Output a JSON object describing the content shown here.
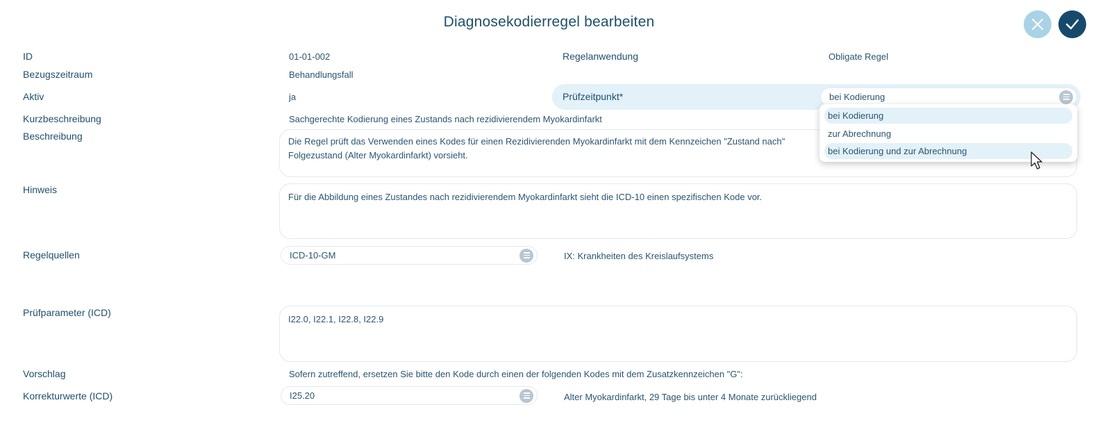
{
  "dialog": {
    "title": "Diagnosekodierregel bearbeiten"
  },
  "actions": {
    "cancel_icon": "close-icon",
    "save_icon": "check-icon"
  },
  "fields": {
    "id": {
      "label": "ID",
      "value": "01-01-002"
    },
    "regelanwendung": {
      "label": "Regelanwendung",
      "value": "Obligate Regel"
    },
    "bezugszeitraum": {
      "label": "Bezugszeitraum",
      "value": "Behandlungsfall"
    },
    "aktiv": {
      "label": "Aktiv",
      "value": "ja"
    },
    "pruefzeitpunkt": {
      "label": "Prüfzeitpunkt*",
      "value": "bei Kodierung",
      "options": [
        "bei Kodierung",
        "zur Abrechnung",
        "bei Kodierung und zur Abrechnung"
      ]
    },
    "kurzbeschreibung": {
      "label": "Kurzbeschreibung",
      "value": "Sachgerechte Kodierung eines Zustands nach rezidivierendem Myokardinfarkt"
    },
    "beschreibung": {
      "label": "Beschreibung",
      "line1": "Die Regel prüft das Verwenden eines Kodes für einen Rezidivierenden Myokardinfarkt mit dem Kennzeichen \"Zustand nach\"",
      "line2": "Folgezustand (Alter Myokardinfarkt) vorsieht."
    },
    "hinweis": {
      "label": "Hinweis",
      "value": "Für die Abbildung eines Zustandes nach rezidivierendem Myokardinfarkt sieht die ICD-10 einen spezifischen Kode vor."
    },
    "regelquellen": {
      "label": "Regelquellen",
      "value": "ICD-10-GM",
      "description": "IX: Krankheiten des Kreislaufsystems"
    },
    "pruefparameter": {
      "label": "Prüfparameter (ICD)",
      "value": "I22.0, I22.1, I22.8, I22.9"
    },
    "vorschlag": {
      "label": "Vorschlag",
      "value": "Sofern zutreffend, ersetzen Sie bitte den Kode durch einen der folgenden Kodes mit dem Zusatzkennzeichen \"G\":"
    },
    "korrekturwerte": {
      "label": "Korrekturwerte (ICD)",
      "value": "I25.20",
      "description": "Alter Myokardinfarkt, 29 Tage bis unter 4 Monate zurückliegend"
    }
  },
  "colors": {
    "primary": "#154a6c",
    "accent_light": "#a8d3e6",
    "row_highlight": "#e3f1f9",
    "text": "#1e4f70"
  }
}
